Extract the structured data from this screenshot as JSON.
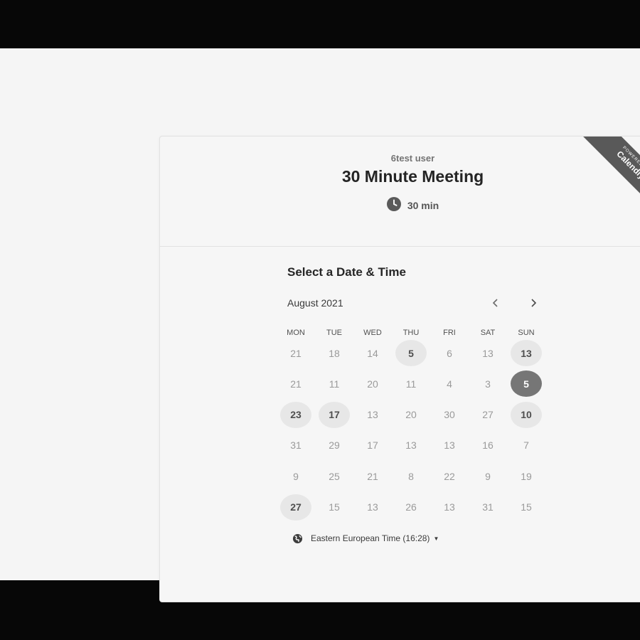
{
  "event": {
    "owner": "6test user",
    "title": "30 Minute Meeting",
    "duration": "30 min"
  },
  "badge": {
    "small": "POWERED BY",
    "large": "Calendly"
  },
  "calendar": {
    "section_title": "Select a Date & Time",
    "month": "August 2021",
    "weekdays": [
      "MON",
      "TUE",
      "WED",
      "THU",
      "FRI",
      "SAT",
      "SUN"
    ],
    "weeks": [
      [
        {
          "label": "21",
          "state": "unavailable"
        },
        {
          "label": "18",
          "state": "unavailable"
        },
        {
          "label": "14",
          "state": "unavailable"
        },
        {
          "label": "5",
          "state": "available"
        },
        {
          "label": "6",
          "state": "unavailable"
        },
        {
          "label": "13",
          "state": "unavailable"
        },
        {
          "label": "13",
          "state": "available"
        }
      ],
      [
        {
          "label": "21",
          "state": "unavailable"
        },
        {
          "label": "11",
          "state": "unavailable"
        },
        {
          "label": "20",
          "state": "unavailable"
        },
        {
          "label": "11",
          "state": "unavailable"
        },
        {
          "label": "4",
          "state": "unavailable"
        },
        {
          "label": "3",
          "state": "unavailable"
        },
        {
          "label": "5",
          "state": "selected"
        }
      ],
      [
        {
          "label": "23",
          "state": "available"
        },
        {
          "label": "17",
          "state": "available"
        },
        {
          "label": "13",
          "state": "unavailable"
        },
        {
          "label": "20",
          "state": "unavailable"
        },
        {
          "label": "30",
          "state": "unavailable"
        },
        {
          "label": "27",
          "state": "unavailable"
        },
        {
          "label": "10",
          "state": "available"
        }
      ],
      [
        {
          "label": "31",
          "state": "unavailable"
        },
        {
          "label": "29",
          "state": "unavailable"
        },
        {
          "label": "17",
          "state": "unavailable"
        },
        {
          "label": "13",
          "state": "unavailable"
        },
        {
          "label": "13",
          "state": "unavailable"
        },
        {
          "label": "16",
          "state": "unavailable"
        },
        {
          "label": "7",
          "state": "unavailable"
        }
      ],
      [
        {
          "label": "9",
          "state": "unavailable"
        },
        {
          "label": "25",
          "state": "unavailable"
        },
        {
          "label": "21",
          "state": "unavailable"
        },
        {
          "label": "8",
          "state": "unavailable"
        },
        {
          "label": "22",
          "state": "unavailable"
        },
        {
          "label": "9",
          "state": "unavailable"
        },
        {
          "label": "19",
          "state": "unavailable"
        }
      ],
      [
        {
          "label": "27",
          "state": "available"
        },
        {
          "label": "15",
          "state": "unavailable"
        },
        {
          "label": "13",
          "state": "unavailable"
        },
        {
          "label": "26",
          "state": "unavailable"
        },
        {
          "label": "13",
          "state": "unavailable"
        },
        {
          "label": "31",
          "state": "unavailable"
        },
        {
          "label": "15",
          "state": "unavailable"
        }
      ]
    ]
  },
  "timezone": {
    "label": "Eastern European Time (16:28)"
  },
  "icons": {
    "duration": "clock-icon",
    "prev": "chevron-left-icon",
    "next": "chevron-right-icon",
    "timezone": "globe-icon",
    "dropdown": "caret-down-icon"
  },
  "colors": {
    "available_bg": "#e7e7e7",
    "selected_bg": "#767676",
    "ribbon_bg": "#595959",
    "frame": "#070707"
  }
}
